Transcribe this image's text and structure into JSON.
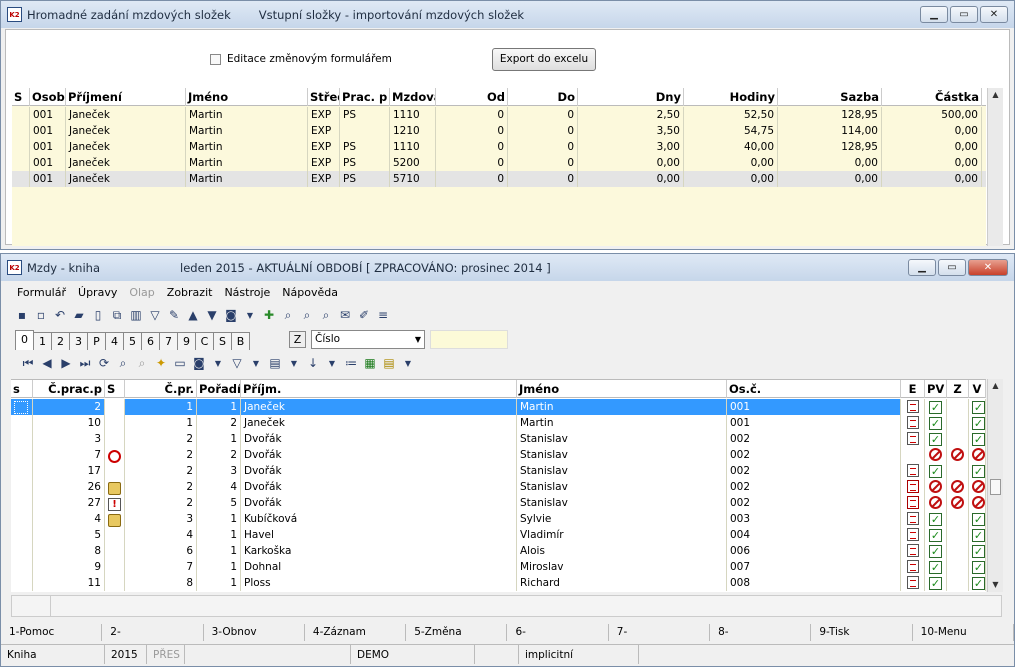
{
  "w1": {
    "title": "Hromadné zadání mzdových složek",
    "subtitle": "Vstupní složky - importování mzdových složek",
    "checkbox_label": "Editace změnovým formulářem",
    "export_label": "Export do excelu",
    "cols": [
      "S",
      "Osobní",
      "Příjmení",
      "Jméno",
      "Středi",
      "Prac. p",
      "Mzdova",
      "Od",
      "Do",
      "Dny",
      "Hodiny",
      "Sazba",
      "Částka"
    ],
    "rows": [
      [
        "",
        "001",
        "Janeček",
        "Martin",
        "EXP",
        "PS",
        "1110",
        "0",
        "0",
        "2,50",
        "52,50",
        "128,95",
        "500,00"
      ],
      [
        "",
        "001",
        "Janeček",
        "Martin",
        "EXP",
        "",
        "1210",
        "0",
        "0",
        "3,50",
        "54,75",
        "114,00",
        "0,00"
      ],
      [
        "",
        "001",
        "Janeček",
        "Martin",
        "EXP",
        "PS",
        "1110",
        "0",
        "0",
        "3,00",
        "40,00",
        "128,95",
        "0,00"
      ],
      [
        "",
        "001",
        "Janeček",
        "Martin",
        "EXP",
        "PS",
        "5200",
        "0",
        "0",
        "0,00",
        "0,00",
        "0,00",
        "0,00"
      ],
      [
        "",
        "001",
        "Janeček",
        "Martin",
        "EXP",
        "PS",
        "5710",
        "0",
        "0",
        "0,00",
        "0,00",
        "0,00",
        "0,00"
      ]
    ]
  },
  "w2": {
    "title": "Mzdy - kniha",
    "subtitle": "leden 2015 - AKTUÁLNÍ OBDOBÍ [ ZPRACOVÁNO: prosinec 2014 ]",
    "menu": [
      "Formulář",
      "Úpravy",
      "Olap",
      "Zobrazit",
      "Nástroje",
      "Nápověda"
    ],
    "tabs": [
      "0",
      "1",
      "2",
      "3",
      "P",
      "4",
      "5",
      "6",
      "7",
      "9",
      "C",
      "S",
      "B"
    ],
    "sort_key": "Z",
    "sort_value": "Číslo",
    "cols": [
      "s",
      "Č.prac.p",
      "S",
      "Č.pr.",
      "Pořadí",
      "Příjm.",
      "Jméno",
      "Os.č.",
      "E",
      "PV",
      "Z",
      "V"
    ],
    "rows": [
      {
        "n": "2",
        "s": "",
        "cpr": "1",
        "por": "1",
        "pr": "Janeček",
        "jm": "Martin",
        "os": "001",
        "e": "doc",
        "pv": "chk",
        "z": "",
        "v": "chk"
      },
      {
        "n": "10",
        "s": "",
        "cpr": "1",
        "por": "2",
        "pr": "Janeček",
        "jm": "Martin",
        "os": "001",
        "e": "doc",
        "pv": "chk",
        "z": "",
        "v": "chk"
      },
      {
        "n": "3",
        "s": "",
        "cpr": "2",
        "por": "1",
        "pr": "Dvořák",
        "jm": "Stanislav",
        "os": "002",
        "e": "doc",
        "pv": "chk",
        "z": "",
        "v": "chk"
      },
      {
        "n": "7",
        "s": "clock-icon",
        "cpr": "2",
        "por": "2",
        "pr": "Dvořák",
        "jm": "Stanislav",
        "os": "002",
        "e": "",
        "pv": "no",
        "z": "no",
        "v": "no"
      },
      {
        "n": "17",
        "s": "",
        "cpr": "2",
        "por": "3",
        "pr": "Dvořák",
        "jm": "Stanislav",
        "os": "002",
        "e": "doc",
        "pv": "chk",
        "z": "",
        "v": "chk"
      },
      {
        "n": "26",
        "s": "folder-arrow-icon",
        "cpr": "2",
        "por": "4",
        "pr": "Dvořák",
        "jm": "Stanislav",
        "os": "002",
        "e": "list",
        "pv": "no",
        "z": "no",
        "v": "no"
      },
      {
        "n": "27",
        "s": "alert-icon",
        "cpr": "2",
        "por": "5",
        "pr": "Dvořák",
        "jm": "Stanislav",
        "os": "002",
        "e": "list",
        "pv": "no",
        "z": "no",
        "v": "no"
      },
      {
        "n": "4",
        "s": "folder-arrow-icon",
        "cpr": "3",
        "por": "1",
        "pr": "Kubíčková",
        "jm": "Sylvie",
        "os": "003",
        "e": "doc",
        "pv": "chk",
        "z": "",
        "v": "chk"
      },
      {
        "n": "5",
        "s": "",
        "cpr": "4",
        "por": "1",
        "pr": "Havel",
        "jm": "Vladimír",
        "os": "004",
        "e": "doc",
        "pv": "chk",
        "z": "",
        "v": "chk"
      },
      {
        "n": "8",
        "s": "",
        "cpr": "6",
        "por": "1",
        "pr": "Karkoška",
        "jm": "Alois",
        "os": "006",
        "e": "doc",
        "pv": "chk",
        "z": "",
        "v": "chk"
      },
      {
        "n": "9",
        "s": "",
        "cpr": "7",
        "por": "1",
        "pr": "Dohnal",
        "jm": "Miroslav",
        "os": "007",
        "e": "doc",
        "pv": "chk",
        "z": "",
        "v": "chk"
      },
      {
        "n": "11",
        "s": "",
        "cpr": "8",
        "por": "1",
        "pr": "Ploss",
        "jm": "Richard",
        "os": "008",
        "e": "doc",
        "pv": "chk",
        "z": "",
        "v": "chk"
      }
    ],
    "fkeys": [
      "1-Pomoc",
      "2-",
      "3-Obnov",
      "4-Záznam",
      "5-Změna",
      "6-",
      "7-",
      "8-",
      "9-Tisk",
      "10-Menu"
    ],
    "status": [
      "Kniha",
      "2015",
      "PŘES",
      "",
      "DEMO",
      "",
      "implicitní",
      ""
    ]
  }
}
